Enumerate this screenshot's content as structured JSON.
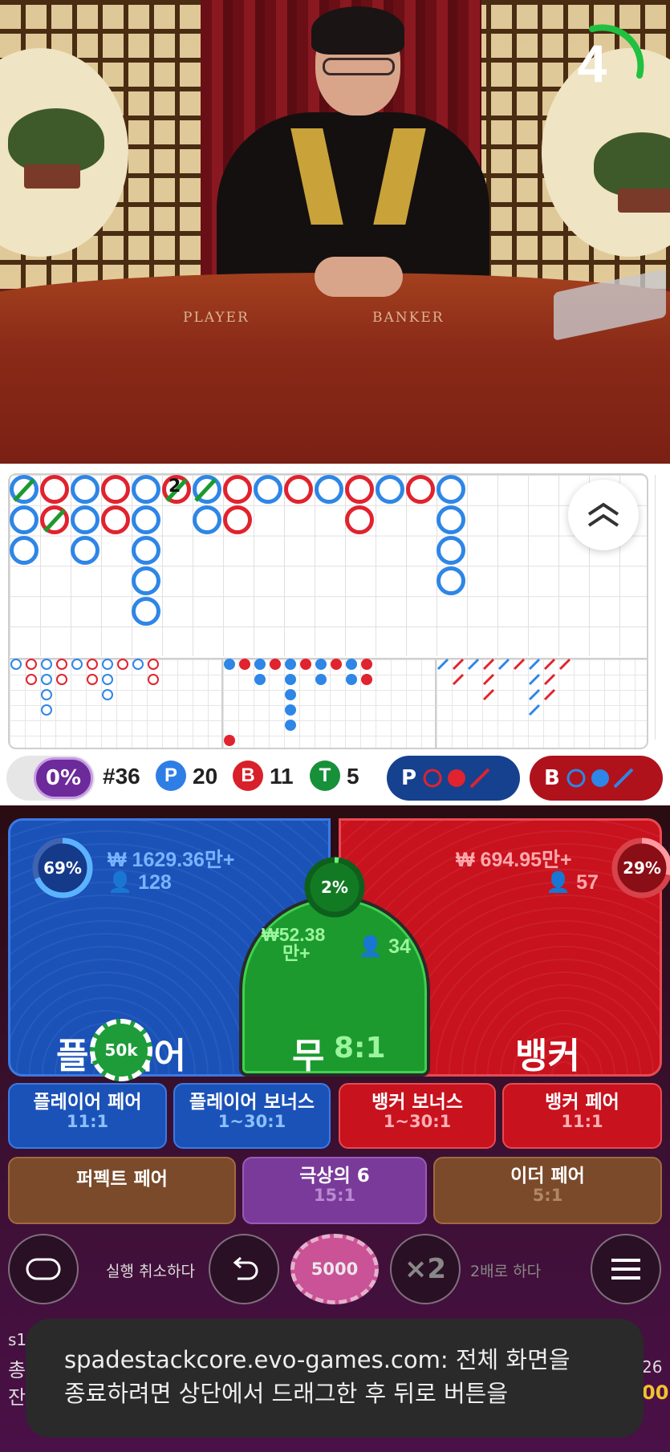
{
  "video": {
    "timer": "4",
    "table_player": "PLAYER",
    "table_banker": "BANKER"
  },
  "roadmap": {
    "marker_number": "2"
  },
  "stats": {
    "percent": "0%",
    "round": "#36",
    "player_letter": "P",
    "player_count": "20",
    "banker_letter": "B",
    "banker_count": "11",
    "tie_letter": "T",
    "tie_count": "5",
    "predict_player": "P",
    "predict_banker": "B"
  },
  "bets": {
    "player": {
      "label": "플레이어",
      "pct": "69%",
      "amount": "₩ 1629.36만+",
      "players": "128"
    },
    "banker": {
      "label": "뱅커",
      "pct": "29%",
      "amount": "₩ 694.95만+",
      "players": "57"
    },
    "tie": {
      "label": "무",
      "odds": "8:1",
      "pct": "2%",
      "amount_line1": "₩52.38",
      "amount_line2": "만+",
      "players": "34"
    },
    "chip_on_player": "50k",
    "side": [
      {
        "label": "플레이어 페어",
        "odds": "11:1"
      },
      {
        "label": "플레이어 보너스",
        "odds": "1~30:1"
      },
      {
        "label": "뱅커 보너스",
        "odds": "1~30:1"
      },
      {
        "label": "뱅커 페어",
        "odds": "11:1"
      }
    ],
    "extra": [
      {
        "label": "퍼펙트 페어",
        "odds": ""
      },
      {
        "label": "극상의 6",
        "odds": "15:1"
      },
      {
        "label": "이더 페어",
        "odds": "5:1"
      }
    ]
  },
  "controls": {
    "undo_label": "실행 취소하다",
    "chip_value": "5000",
    "double_symbol": "×2",
    "double_label": "2배로 하다"
  },
  "footer": {
    "left_line1": "s1",
    "left_line2": "총",
    "left_line3": "잔",
    "right_line1": "26",
    "right_line2": "00"
  },
  "toast": {
    "line1": "spadestackcore.evo-games.com: 전체 화면을",
    "line2": "종료하려면 상단에서 드래그한 후 뒤로 버튼을"
  },
  "colors": {
    "player_blue": "#1b52b8",
    "banker_red": "#c8121e",
    "tie_green": "#1c9a2e",
    "road_blue": "#2e86e6",
    "road_red": "#e0232e"
  }
}
